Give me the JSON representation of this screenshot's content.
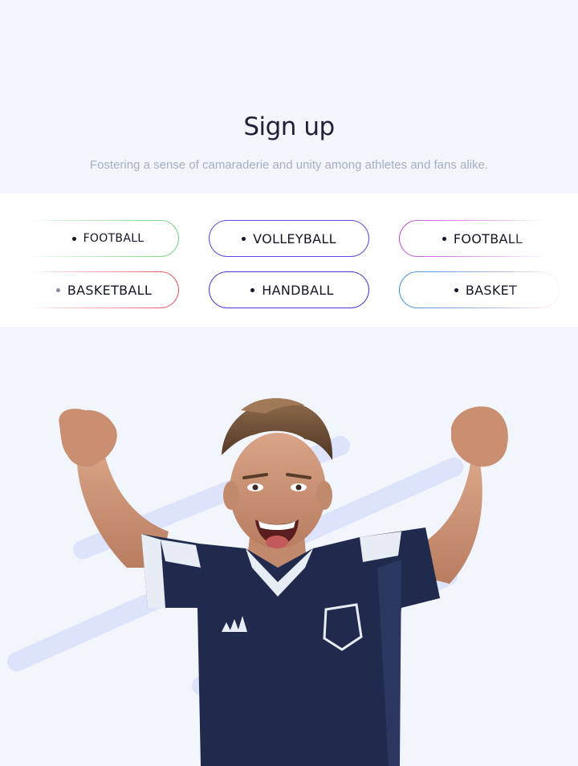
{
  "header": {
    "title": "Sign up",
    "subtitle": "Fostering a sense of camaraderie and unity among athletes and fans alike."
  },
  "sports": {
    "row1": [
      {
        "label": "FOOTBALL",
        "border_gradient": [
          "#ffffff",
          "#6fd27a"
        ]
      },
      {
        "label": "VOLLEYBALL",
        "border_gradient": [
          "#5b48e6",
          "#5b48e6"
        ]
      },
      {
        "label": "FOOTBALL",
        "border_gradient": [
          "#c04ad8",
          "#ffffff"
        ]
      }
    ],
    "row2": [
      {
        "label": "BASKETBALL",
        "border_gradient": [
          "#ffffff",
          "#e84b5d"
        ]
      },
      {
        "label": "HANDBALL",
        "border_gradient": [
          "#4a35d6",
          "#4a35d6"
        ]
      },
      {
        "label": "BASKET",
        "border_gradient": [
          "#3b8fe0",
          "#ffd3d8"
        ]
      }
    ]
  },
  "hero": {
    "subject": "cheering football player in navy jersey with raised fists",
    "colors": {
      "background": "#f3f5fd",
      "stripe": "#dde3fb",
      "jersey": "#1f2a4d",
      "jersey_accent": "#e8ecf4"
    }
  }
}
